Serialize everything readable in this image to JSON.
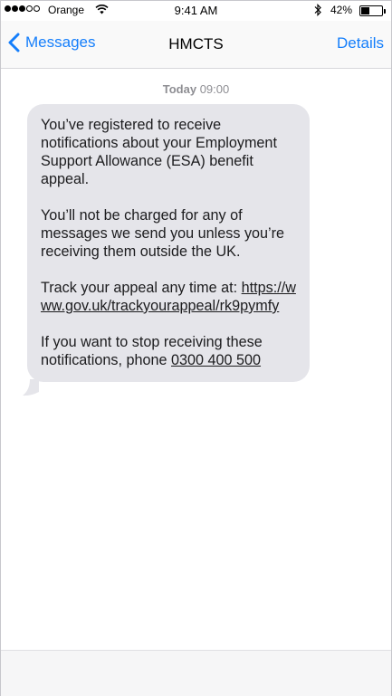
{
  "status_bar": {
    "carrier": "Orange",
    "time": "9:41 AM",
    "battery_percent": "42%",
    "battery_level": 0.42,
    "signal_bars_filled": 3,
    "signal_bars_total": 5
  },
  "nav": {
    "back_label": "Messages",
    "title": "HMCTS",
    "details_label": "Details"
  },
  "thread": {
    "timestamp_day": "Today",
    "timestamp_time": "09:00"
  },
  "message": {
    "para1": "You’ve registered to receive notifications about your Employment Support Allowance (ESA) benefit appeal.",
    "para2": "You’ll not be charged for any of messages we send you unless you’re receiving them outside the UK.",
    "para3_prefix": "Track your appeal any time at: ",
    "para3_link": "https://www.gov.uk/trackyourappeal/rk9pymfy",
    "para4_prefix": "If you want to stop receiving these notifications, phone ",
    "para4_phone": "0300 400 500"
  },
  "colors": {
    "accent": "#147efb",
    "bubble": "#e5e5ea",
    "timestamp": "#8e8e93"
  }
}
